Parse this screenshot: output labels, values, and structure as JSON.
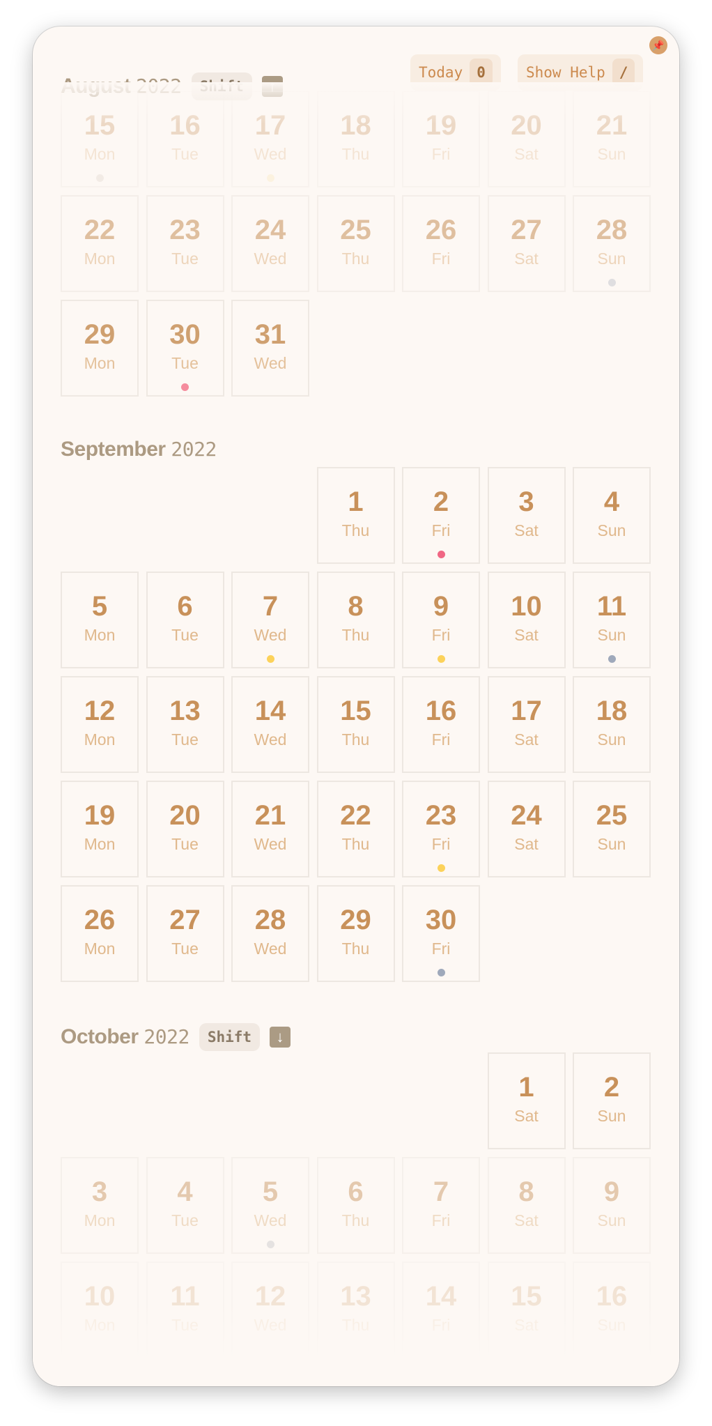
{
  "header": {
    "pin_icon": "pin-icon",
    "today_label": "Today",
    "today_key": "0",
    "help_label": "Show Help",
    "help_key": "/"
  },
  "months": [
    {
      "name": "August",
      "year": "2022",
      "shortcut": "Shift",
      "arrow": "↑",
      "first_weekday": 0,
      "days": [
        {
          "n": "15",
          "d": "Mon",
          "dot": "#dccfc6"
        },
        {
          "n": "16",
          "d": "Tue"
        },
        {
          "n": "17",
          "d": "Wed",
          "dot": "#fbe7b2"
        },
        {
          "n": "18",
          "d": "Thu"
        },
        {
          "n": "19",
          "d": "Fri"
        },
        {
          "n": "20",
          "d": "Sat"
        },
        {
          "n": "21",
          "d": "Sun"
        },
        {
          "n": "22",
          "d": "Mon"
        },
        {
          "n": "23",
          "d": "Tue"
        },
        {
          "n": "24",
          "d": "Wed"
        },
        {
          "n": "25",
          "d": "Thu"
        },
        {
          "n": "26",
          "d": "Fri"
        },
        {
          "n": "27",
          "d": "Sat"
        },
        {
          "n": "28",
          "d": "Sun",
          "dot": "#c7c9d0"
        },
        {
          "n": "29",
          "d": "Mon"
        },
        {
          "n": "30",
          "d": "Tue",
          "dot": "#f47a8e"
        },
        {
          "n": "31",
          "d": "Wed"
        }
      ]
    },
    {
      "name": "September",
      "year": "2022",
      "first_weekday": 3,
      "days": [
        {
          "n": "1",
          "d": "Thu"
        },
        {
          "n": "2",
          "d": "Fri",
          "dot": "#f06784"
        },
        {
          "n": "3",
          "d": "Sat"
        },
        {
          "n": "4",
          "d": "Sun"
        },
        {
          "n": "5",
          "d": "Mon"
        },
        {
          "n": "6",
          "d": "Tue"
        },
        {
          "n": "7",
          "d": "Wed",
          "dot": "#fcd25a"
        },
        {
          "n": "8",
          "d": "Thu"
        },
        {
          "n": "9",
          "d": "Fri",
          "dot": "#fcd25a"
        },
        {
          "n": "10",
          "d": "Sat"
        },
        {
          "n": "11",
          "d": "Sun",
          "dot": "#9fa9bb"
        },
        {
          "n": "12",
          "d": "Mon"
        },
        {
          "n": "13",
          "d": "Tue"
        },
        {
          "n": "14",
          "d": "Wed"
        },
        {
          "n": "15",
          "d": "Thu"
        },
        {
          "n": "16",
          "d": "Fri"
        },
        {
          "n": "17",
          "d": "Sat"
        },
        {
          "n": "18",
          "d": "Sun"
        },
        {
          "n": "19",
          "d": "Mon"
        },
        {
          "n": "20",
          "d": "Tue"
        },
        {
          "n": "21",
          "d": "Wed"
        },
        {
          "n": "22",
          "d": "Thu"
        },
        {
          "n": "23",
          "d": "Fri",
          "dot": "#fcd25a"
        },
        {
          "n": "24",
          "d": "Sat"
        },
        {
          "n": "25",
          "d": "Sun"
        },
        {
          "n": "26",
          "d": "Mon"
        },
        {
          "n": "27",
          "d": "Tue"
        },
        {
          "n": "28",
          "d": "Wed"
        },
        {
          "n": "29",
          "d": "Thu"
        },
        {
          "n": "30",
          "d": "Fri",
          "dot": "#9fa9bb"
        }
      ]
    },
    {
      "name": "October",
      "year": "2022",
      "shortcut": "Shift",
      "arrow": "↓",
      "first_weekday": 5,
      "days": [
        {
          "n": "1",
          "d": "Sat"
        },
        {
          "n": "2",
          "d": "Sun"
        },
        {
          "n": "3",
          "d": "Mon"
        },
        {
          "n": "4",
          "d": "Tue"
        },
        {
          "n": "5",
          "d": "Wed",
          "dot": "#c9c9cc"
        },
        {
          "n": "6",
          "d": "Thu"
        },
        {
          "n": "7",
          "d": "Fri"
        },
        {
          "n": "8",
          "d": "Sat"
        },
        {
          "n": "9",
          "d": "Sun"
        },
        {
          "n": "10",
          "d": "Mon"
        },
        {
          "n": "11",
          "d": "Tue"
        },
        {
          "n": "12",
          "d": "Wed"
        },
        {
          "n": "13",
          "d": "Thu"
        },
        {
          "n": "14",
          "d": "Fri"
        },
        {
          "n": "15",
          "d": "Sat"
        },
        {
          "n": "16",
          "d": "Sun"
        }
      ]
    }
  ]
}
